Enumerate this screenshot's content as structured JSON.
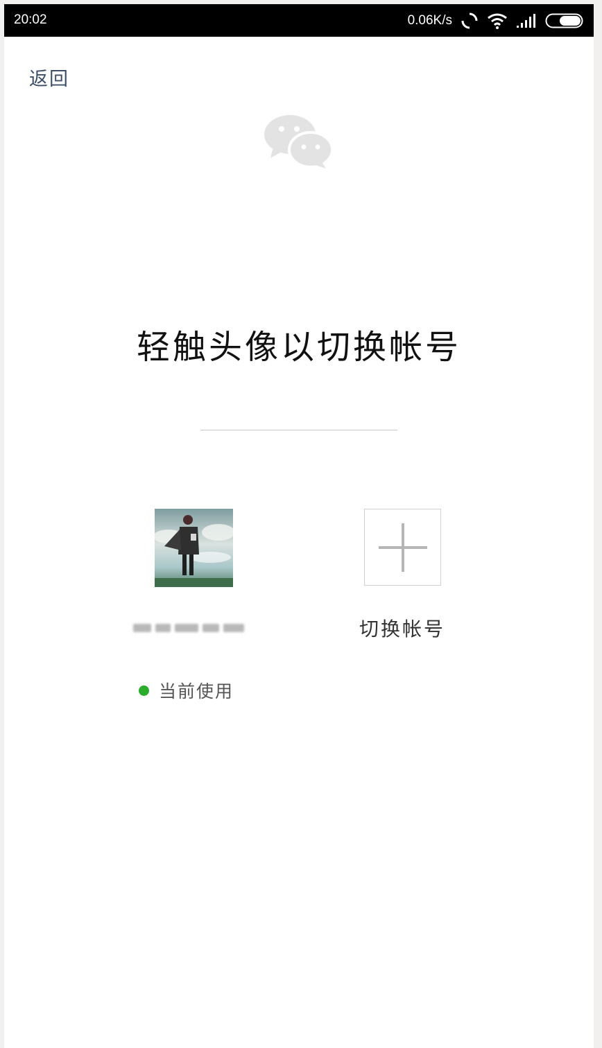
{
  "status_bar": {
    "time": "20:02",
    "network_speed": "0.06K/s",
    "icons": [
      "sync-icon",
      "wifi-icon",
      "signal-icon",
      "battery-icon"
    ]
  },
  "nav": {
    "back_label": "返回"
  },
  "logo": {
    "icon": "wechat-logo-icon"
  },
  "title": "轻触头像以切换帐号",
  "accounts": [
    {
      "status_label": "当前使用",
      "status_color": "#2bad2b"
    }
  ],
  "add_account": {
    "label": "切换帐号",
    "icon": "plus-icon"
  }
}
